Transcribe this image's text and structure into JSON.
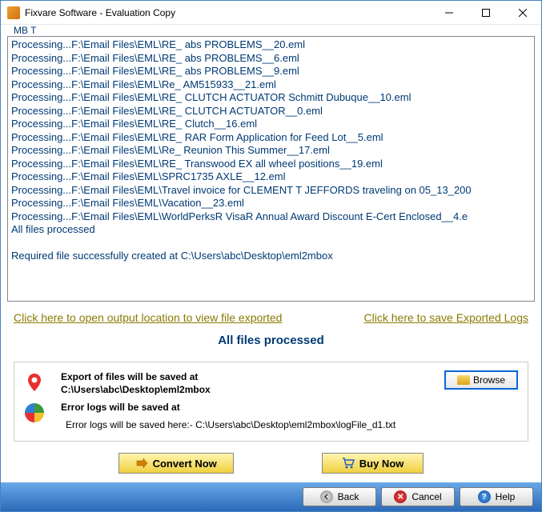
{
  "titlebar": {
    "title": "Fixvare Software - Evaluation Copy"
  },
  "toptext": "MB    T",
  "log_lines": [
    "Processing...F:\\Email Files\\EML\\RE_ abs PROBLEMS__20.eml",
    "Processing...F:\\Email Files\\EML\\RE_ abs PROBLEMS__6.eml",
    "Processing...F:\\Email Files\\EML\\RE_ abs PROBLEMS__9.eml",
    "Processing...F:\\Email Files\\EML\\Re_ AM515933__21.eml",
    "Processing...F:\\Email Files\\EML\\RE_ CLUTCH ACTUATOR Schmitt Dubuque__10.eml",
    "Processing...F:\\Email Files\\EML\\RE_ CLUTCH ACTUATOR__0.eml",
    "Processing...F:\\Email Files\\EML\\RE_ Clutch__16.eml",
    "Processing...F:\\Email Files\\EML\\RE_ RAR Form Application for Feed Lot__5.eml",
    "Processing...F:\\Email Files\\EML\\Re_ Reunion This Summer__17.eml",
    "Processing...F:\\Email Files\\EML\\RE_ Transwood EX all wheel positions__19.eml",
    "Processing...F:\\Email Files\\EML\\SPRC1735 AXLE__12.eml",
    "Processing...F:\\Email Files\\EML\\Travel invoice for CLEMENT T JEFFORDS traveling on 05_13_200",
    "Processing...F:\\Email Files\\EML\\Vacation__23.eml",
    "Processing...F:\\Email Files\\EML\\WorldPerksR VisaR Annual Award Discount E-Cert Enclosed__4.e",
    "All files processed",
    "",
    "Required file successfully created at C:\\Users\\abc\\Desktop\\eml2mbox"
  ],
  "links": {
    "open_output": "Click here to open output location to view file exported",
    "save_logs": "Click here to save Exported Logs"
  },
  "status": "All files processed",
  "export": {
    "label": "Export of files will be saved at",
    "path": "C:\\Users\\abc\\Desktop\\eml2mbox",
    "browse": "Browse"
  },
  "errorlog": {
    "label": "Error logs will be saved at",
    "path": "Error logs will be saved here:- C:\\Users\\abc\\Desktop\\eml2mbox\\logFile_d1.txt"
  },
  "actions": {
    "convert": "Convert Now",
    "buy": "Buy Now"
  },
  "footer": {
    "back": "Back",
    "cancel": "Cancel",
    "help": "Help"
  }
}
